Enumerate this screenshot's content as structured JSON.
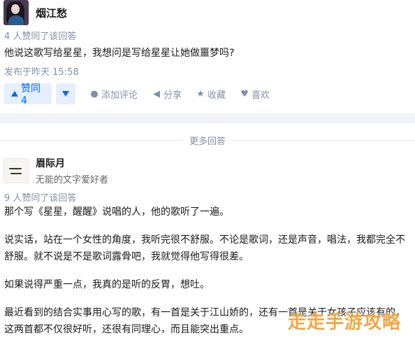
{
  "answer1": {
    "author_name": "烟江愁",
    "upvote_note": "4 人赞同了该回答",
    "text": "他说这歌写给星星，我想问是写给星星让她做噩梦吗?",
    "publish_time": "发布于昨天 15:58",
    "actions": {
      "upvote_label": "赞同 4",
      "comment_label": "添加评论",
      "share_label": "分享",
      "collect_label": "收藏",
      "like_label": "喜欢"
    }
  },
  "more_answers_label": "更多回答",
  "answer2": {
    "author_name": "眉际月",
    "author_bio": "无能的文字爱好者",
    "upvote_note": "9 人赞同了该回答",
    "paragraphs": [
      "那个写《星星，醒醒》说唱的人，他的歌听了一遍。",
      "说实话，站在一个女性的角度，我听完很不舒服。不论是歌词，还是声音，唱法，我都完全不舒服。就不说是不是歌词露骨吧，我就觉得他写得很差。",
      "如果说得严重一点，我真的是听的反胃，想吐。",
      "最近看到的结合实事用心写的歌，有一首是关于江山娇的，还有一首是关于女孩子应该有的，这两首都不仅很好听，还很有同理心，而且能突出重点。"
    ]
  },
  "watermark_text": "走走手游攻略",
  "colors": {
    "accent": "#0066ff",
    "muted": "#8590a6",
    "gap": "#f0f2f5",
    "watermark": "#f2a23a"
  },
  "icons": {
    "comment": "comment-icon",
    "share": "share-icon",
    "collect": "star-icon",
    "like": "heart-icon"
  }
}
